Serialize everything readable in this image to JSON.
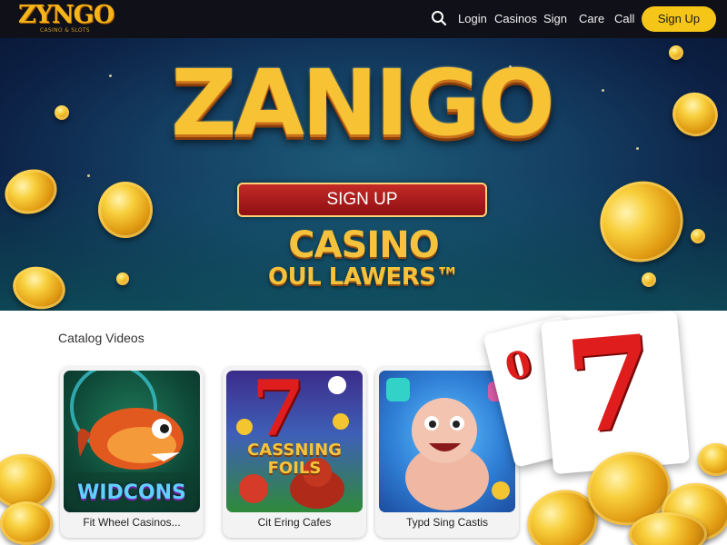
{
  "header": {
    "logo_text": "ZYNGO",
    "logo_tagline": "CASINO & SLOTS",
    "search_icon": "search-icon",
    "nav_links": [
      "Login",
      "Casinos",
      "Sign",
      "Care",
      "Call"
    ],
    "cta_label": "Sign Up"
  },
  "hero": {
    "title": "ZANIGO",
    "button_label": "SIGN UP",
    "subtitle_line1": "CASINO",
    "subtitle_line2": "OUL LAWERS™"
  },
  "games_section": {
    "title": "Catalog Videos",
    "cards": [
      {
        "art_text": "WIDCONS",
        "label": "Fit Wheel Casinos..."
      },
      {
        "art_text": "CASSNING FOILS",
        "label": "Cit Ering Cafes"
      },
      {
        "art_text": "",
        "label": "Typd Sing Castis"
      }
    ]
  },
  "colors": {
    "nav_bg": "#101018",
    "accent_gold": "#f5c518",
    "hero_button_red": "#b81f1f",
    "seven_red": "#e01d1d"
  }
}
